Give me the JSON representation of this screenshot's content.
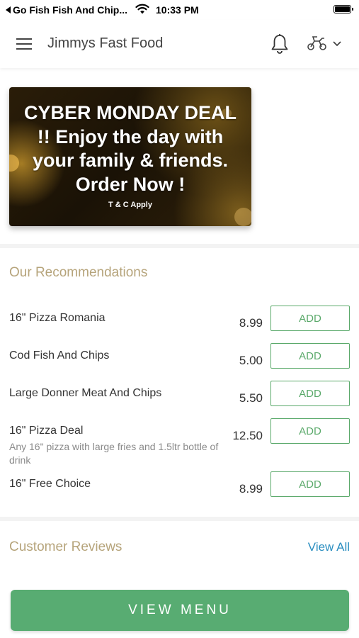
{
  "status_bar": {
    "back_app": "Go Fish Fish And Chip...",
    "time": "10:33 PM"
  },
  "header": {
    "title": "Jimmys Fast Food",
    "icons": [
      "menu-icon",
      "bell-icon",
      "scooter-icon",
      "chevron-down-icon"
    ]
  },
  "banner": {
    "headline": "CYBER MONDAY DEAL !! Enjoy the day with your family & friends. Order Now !",
    "subtext": "T & C Apply"
  },
  "recommendations": {
    "title": "Our Recommendations",
    "items": [
      {
        "name": "16\" Pizza Romania",
        "description": "",
        "price": "8.99",
        "button": "ADD"
      },
      {
        "name": "Cod Fish  And Chips",
        "description": "",
        "price": "5.00",
        "button": "ADD"
      },
      {
        "name": "Large Donner Meat And Chips",
        "description": "",
        "price": "5.50",
        "button": "ADD"
      },
      {
        "name": "16\" Pizza Deal",
        "description": "Any 16\" pizza with large fries and 1.5ltr bottle of drink",
        "price": "12.50",
        "button": "ADD"
      },
      {
        "name": "16\" Free Choice",
        "description": "",
        "price": "8.99",
        "button": "ADD"
      }
    ]
  },
  "reviews": {
    "title": "Customer Reviews",
    "view_all": "View All"
  },
  "cta": {
    "label": "VIEW MENU"
  },
  "colors": {
    "accent_green": "#58ac72",
    "section_title": "#b6a47b",
    "link_blue": "#2b8ec0"
  }
}
